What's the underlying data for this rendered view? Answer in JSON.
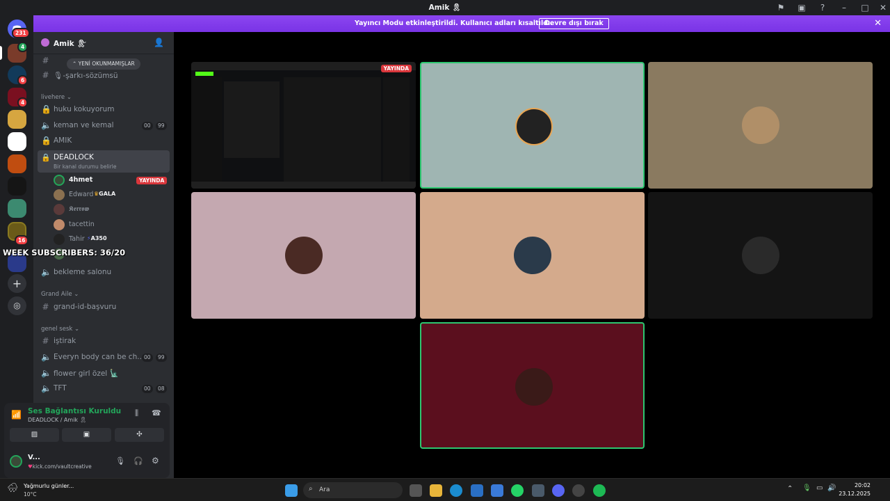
{
  "window": {
    "title": "Amik 🎗"
  },
  "banner": {
    "text": "Yayıncı Modu etkinleştirildi. Kullanıcı adları kısaltıldı.",
    "button": "Devre dışı bırak"
  },
  "servers": {
    "dm_badge": "231",
    "badges": [
      "4",
      "6",
      "4",
      "16"
    ]
  },
  "guild": {
    "name": "Amik 🎗"
  },
  "new_unreads": "YENİ OKUNMAMIŞLAR",
  "channels": [
    {
      "label": "şarkı-sözümsü",
      "prefix": "🎙-"
    },
    {
      "category": "livehere"
    },
    {
      "label": "huku kokuyorum"
    },
    {
      "label": "keman ve kemal",
      "pill_a": "00",
      "pill_b": "99"
    },
    {
      "label": "AMIK"
    },
    {
      "label": "DEADLOCK",
      "status": "Bir kanal durumu belirle"
    },
    {
      "label": "bekleme salonu"
    },
    {
      "category": "Grand Aile"
    },
    {
      "label": "grand-id-başvuru"
    },
    {
      "category": "genel sesk"
    },
    {
      "label": "iştirak"
    },
    {
      "label": "Everyn body can be ch...",
      "pill_a": "00",
      "pill_b": "99"
    },
    {
      "label": "flower girl özel 🗽"
    },
    {
      "label": "TFT",
      "pill_a": "00",
      "pill_b": "08"
    }
  ],
  "voice_users": [
    {
      "name": "4hmet",
      "live": "YAYINDA"
    },
    {
      "name": "Edward",
      "tag": "GALA"
    },
    {
      "name": "𝕶𝖊𝖗𝖗𝖔𝖜"
    },
    {
      "name": "tacettin"
    },
    {
      "name": "Tahir",
      "tag": "A350"
    }
  ],
  "overlay": "WEEK SUBSCRIBERS: 36/20",
  "voice_panel": {
    "status": "Ses Bağlantısı Kuruldu",
    "channel": "DEADLOCK / Amik 🎗"
  },
  "user_panel": {
    "name": "V...",
    "status": "kick.com/vaultcreative"
  },
  "stage": {
    "live_badge": "YAYINDA",
    "tiles": [
      {
        "bg": "#0f1012",
        "kind": "stream"
      },
      {
        "bg": "#9fb5b2",
        "speaking": true
      },
      {
        "bg": "#8a7a60"
      },
      {
        "bg": "#c4a8b0"
      },
      {
        "bg": "#d4aa8c"
      },
      {
        "bg": "#141414"
      },
      {
        "bg": "#5b0f1e",
        "speaking": true
      }
    ]
  },
  "taskbar": {
    "weather": "Yağmurlu günler...",
    "temp": "10°C",
    "search": "Ara",
    "time": "20:02",
    "date": "23.12.2025"
  }
}
